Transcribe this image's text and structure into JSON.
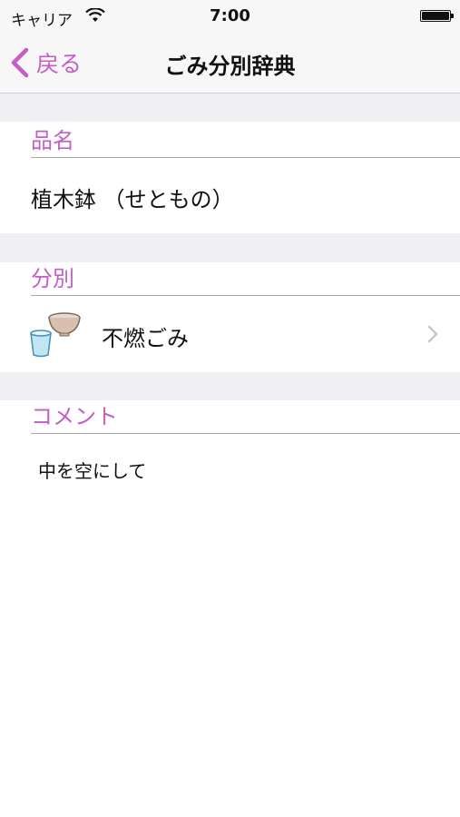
{
  "status_bar": {
    "carrier": "キャリア",
    "time": "7:00",
    "wifi_icon": "wifi-icon",
    "battery_level": 1.0
  },
  "nav": {
    "back_label": "戻る",
    "title": "ごみ分別辞典",
    "back_icon": "chevron-left-icon",
    "accent_color": "#c45ec6"
  },
  "sections": {
    "item_name": {
      "header": "品名",
      "value": "植木鉢 （せともの）"
    },
    "category": {
      "header": "分別",
      "value": "不燃ごみ",
      "icon": "bowl-and-cup-icon",
      "disclosure_icon": "chevron-right-icon"
    },
    "comment": {
      "header": "コメント",
      "value": "中を空にして"
    }
  }
}
